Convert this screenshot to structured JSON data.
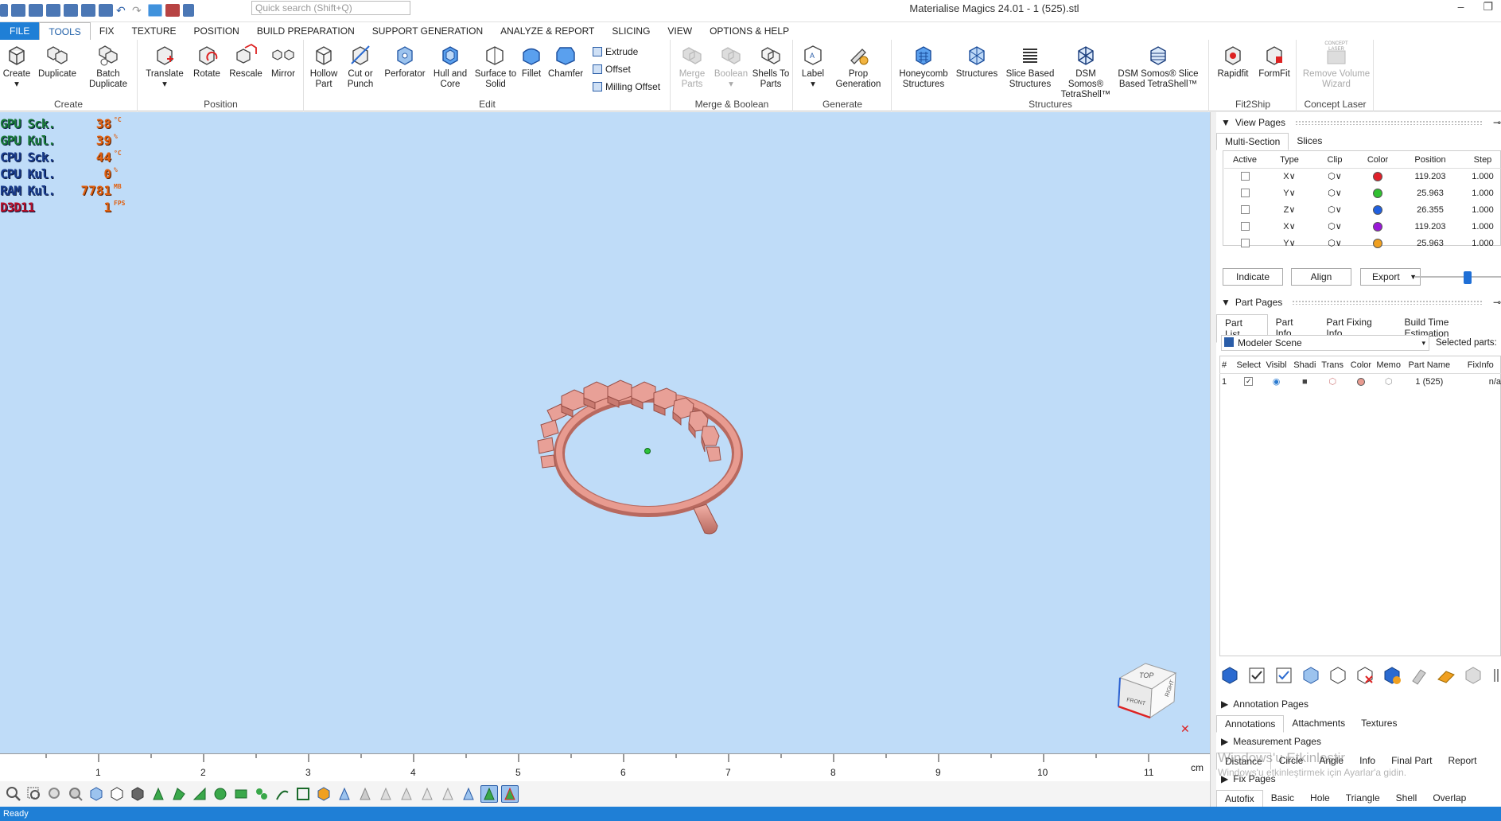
{
  "window": {
    "title": "Materialise Magics 24.01 - 1 (525).stl",
    "search_placeholder": "Quick search (Shift+Q)"
  },
  "menu": [
    "FILE",
    "TOOLS",
    "FIX",
    "TEXTURE",
    "POSITION",
    "BUILD PREPARATION",
    "SUPPORT GENERATION",
    "ANALYZE & REPORT",
    "SLICING",
    "VIEW",
    "OPTIONS & HELP"
  ],
  "ribbon": {
    "create": {
      "label": "Create",
      "buttons": [
        "Create",
        "Duplicate",
        "Batch Duplicate"
      ]
    },
    "position": {
      "label": "Position",
      "buttons": [
        "Translate",
        "Rotate",
        "Rescale",
        "Mirror"
      ]
    },
    "edit": {
      "label": "Edit",
      "buttons": [
        "Hollow Part",
        "Cut or Punch",
        "Perforator",
        "Hull and Core",
        "Surface to Solid",
        "Fillet",
        "Chamfer"
      ],
      "small": [
        "Extrude",
        "Offset",
        "Milling Offset"
      ]
    },
    "merge": {
      "label": "Merge & Boolean",
      "buttons": [
        "Merge Parts",
        "Boolean",
        "Shells To Parts"
      ]
    },
    "generate": {
      "label": "Generate",
      "buttons": [
        "Label",
        "Prop Generation"
      ]
    },
    "structures": {
      "label": "Structures",
      "buttons": [
        "Honeycomb Structures",
        "Structures",
        "Slice Based Structures",
        "DSM Somos® TetraShell™",
        "DSM Somos® Slice Based TetraShell™"
      ]
    },
    "fit2ship": {
      "label": "Fit2Ship",
      "buttons": [
        "Rapidfit",
        "FormFit"
      ]
    },
    "concept": {
      "label": "Concept Laser",
      "buttons": [
        "Remove Volume Wizard"
      ],
      "badge": "CONCEPT LASER"
    }
  },
  "hud": [
    {
      "label": "GPU Sck.",
      "value": "38",
      "unit": "°C"
    },
    {
      "label": "GPU Kul.",
      "value": "39",
      "unit": "%"
    },
    {
      "label": "CPU Sck.",
      "value": "44",
      "unit": "°C"
    },
    {
      "label": "CPU Kul.",
      "value": "0",
      "unit": "%"
    },
    {
      "label": "RAM Kul.",
      "value": "7781",
      "unit": "MB"
    },
    {
      "label": "D3D11",
      "value": "1",
      "unit": "FPS"
    }
  ],
  "viewcube": {
    "top": "TOP",
    "front": "FRONT",
    "right": "RIGHT"
  },
  "ruler": {
    "ticks": [
      "1",
      "2",
      "3",
      "4",
      "5",
      "6",
      "7",
      "8",
      "9",
      "10",
      "11"
    ],
    "unit": "cm"
  },
  "status": "Ready",
  "view_pages": {
    "title": "View Pages",
    "tabs": [
      "Multi-Section",
      "Slices"
    ],
    "columns": [
      "Active",
      "Type",
      "Clip",
      "Color",
      "Position",
      "Step"
    ],
    "rows": [
      {
        "type": "X∨",
        "color": "#e0202a",
        "position": "119.203",
        "step": "1.000"
      },
      {
        "type": "Y∨",
        "color": "#30c030",
        "position": "25.963",
        "step": "1.000"
      },
      {
        "type": "Z∨",
        "color": "#2060e0",
        "position": "26.355",
        "step": "1.000"
      },
      {
        "type": "X∨",
        "color": "#9a18d8",
        "position": "119.203",
        "step": "1.000"
      },
      {
        "type": "Y∨",
        "color": "#f0a020",
        "position": "25.963",
        "step": "1.000"
      }
    ],
    "buttons": [
      "Indicate",
      "Align",
      "Export"
    ],
    "slider_value": 0.75
  },
  "part_pages": {
    "title": "Part Pages",
    "tabs": [
      "Part List",
      "Part Info",
      "Part Fixing Info",
      "Build Time Estimation"
    ],
    "scene": "Modeler Scene",
    "selected_label": "Selected parts:",
    "columns": [
      "#",
      "Select",
      "Visibl",
      "Shadi",
      "Trans",
      "Color",
      "Memo",
      "Part Name",
      "FixInfo"
    ],
    "rows": [
      {
        "num": "1",
        "name": "1 (525)",
        "fix": "n/a",
        "color": "#e89b90"
      }
    ]
  },
  "annotation_pages": {
    "title": "Annotation Pages",
    "tabs": [
      "Annotations",
      "Attachments",
      "Textures"
    ]
  },
  "measurement_pages": {
    "title": "Measurement Pages",
    "tabs": [
      "Distance",
      "Circle",
      "Angle",
      "Info",
      "Final Part",
      "Report"
    ]
  },
  "fix_pages": {
    "title": "Fix Pages",
    "tabs": [
      "Autofix",
      "Basic",
      "Hole",
      "Triangle",
      "Shell",
      "Overlap"
    ]
  },
  "watermark": {
    "line1": "Windows'u Etkinleştir",
    "line2": "Windows'u etkinleştirmek için Ayarlar'a gidin."
  }
}
